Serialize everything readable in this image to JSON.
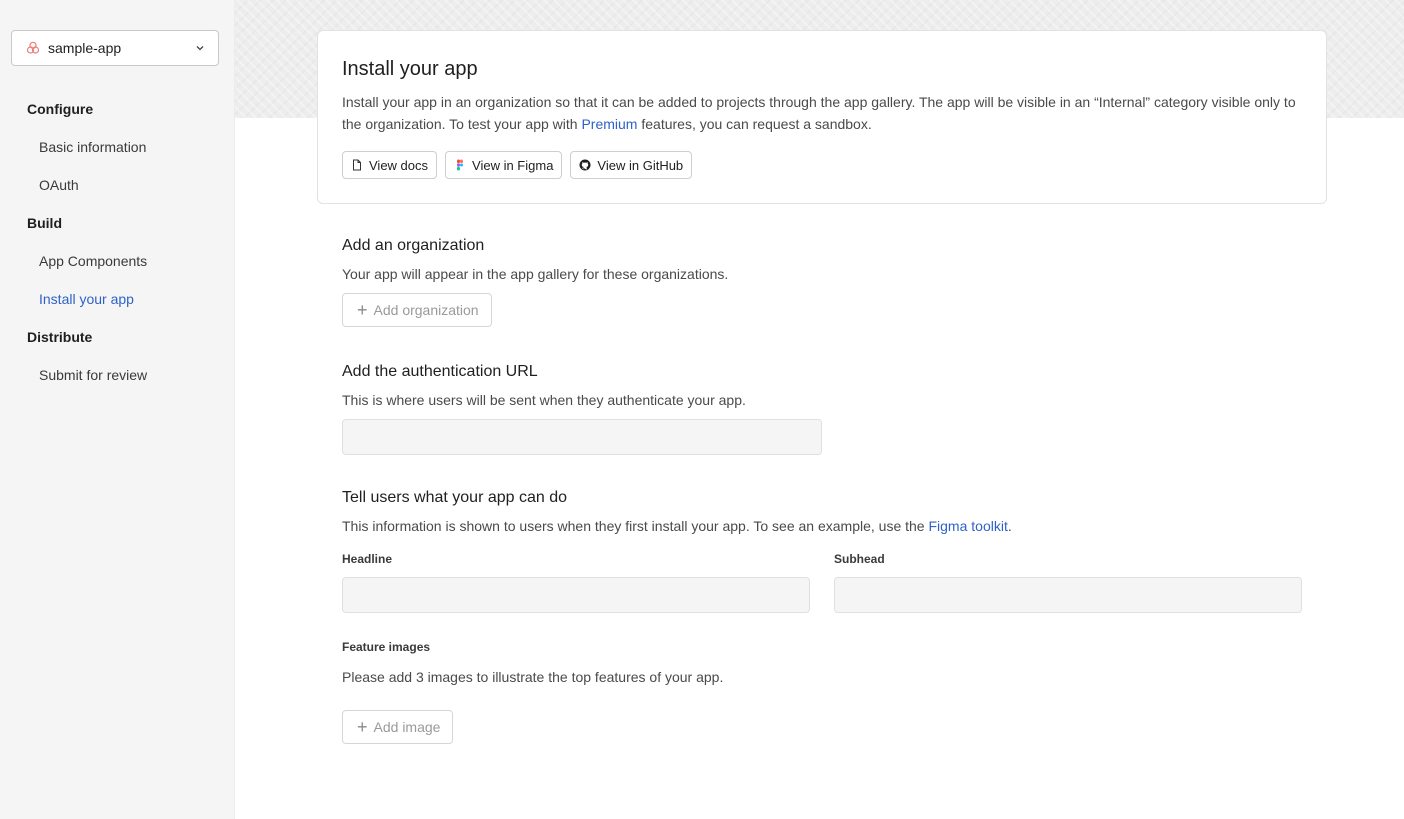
{
  "sidebar": {
    "app_selector": {
      "name": "sample-app",
      "logo_icon": "app-logo-icon",
      "chevron_icon": "chevron-down-icon"
    },
    "groups": [
      {
        "heading": "Configure",
        "items": [
          {
            "label": "Basic information"
          },
          {
            "label": "OAuth"
          }
        ]
      },
      {
        "heading": "Build",
        "items": [
          {
            "label": "App Components"
          },
          {
            "label": "Install your app",
            "active": true
          }
        ]
      },
      {
        "heading": "Distribute",
        "items": [
          {
            "label": "Submit for review"
          }
        ]
      }
    ]
  },
  "card": {
    "title": "Install your app",
    "description_part1": "Install your app in an organization so that it can be added to projects through the app gallery. The app will be visible in an “Internal” category visible only to the organization. To test your app with ",
    "description_link": "Premium",
    "description_part2": " features, you can request a sandbox.",
    "buttons": {
      "docs": "View docs",
      "figma": "View in Figma",
      "github": "View in GitHub"
    }
  },
  "organization": {
    "title": "Add an organization",
    "subtitle": "Your app will appear in the app gallery for these organizations.",
    "button": "Add organization"
  },
  "auth": {
    "title": "Add the authentication URL",
    "subtitle": "This is where users will be sent when they authenticate your app.",
    "value": ""
  },
  "features": {
    "title": "Tell users what your app can do",
    "subtitle_part1": "This information is shown to users when they first install your app. To see an example, use the ",
    "subtitle_link": "Figma toolkit",
    "subtitle_part2": ".",
    "headline_label": "Headline",
    "headline_value": "",
    "subhead_label": "Subhead",
    "subhead_value": "",
    "images_label": "Feature images",
    "images_hint": "Please add 3 images to illustrate the top features of your app.",
    "add_image_button": "Add image"
  },
  "colors": {
    "accent": "#2f62c8",
    "sidebar_bg": "#f5f5f5",
    "field_bg": "#f5f5f5"
  }
}
